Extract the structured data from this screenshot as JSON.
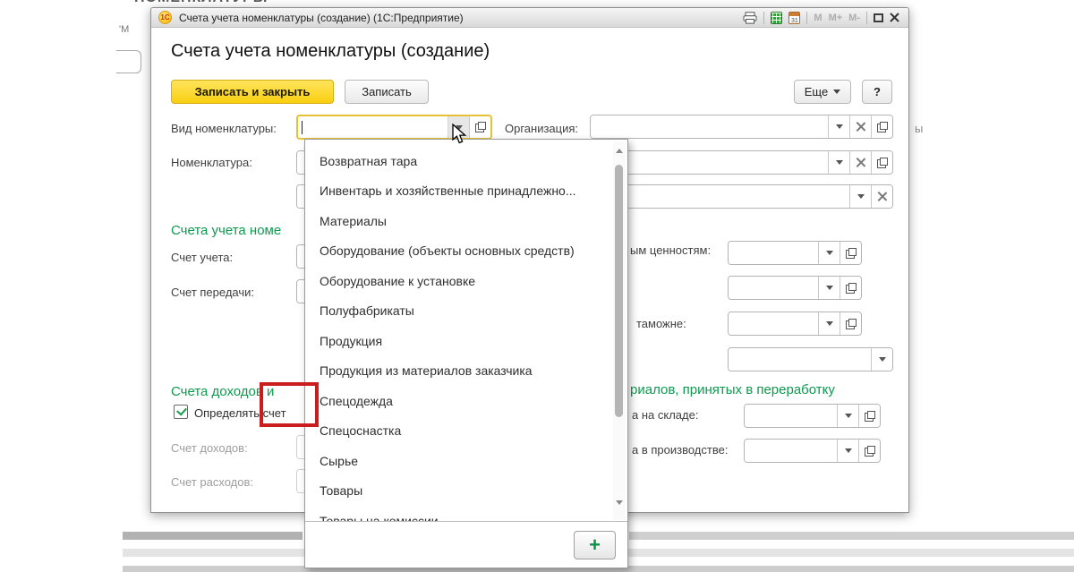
{
  "backdrop": {
    "top_fragment": "НОМЕНКЛАТУРЫ",
    "left_fragment": "'М",
    "right_fragment": "ы"
  },
  "titlebar": {
    "logo_text": "1С",
    "title": "Счета учета номенклатуры (создание)  (1С:Предприятие)",
    "calendar_day": "31",
    "memory_buttons": [
      "M",
      "M+",
      "M-"
    ]
  },
  "header": {
    "title": "Счета учета номенклатуры (создание)",
    "save_and_close": "Записать и закрыть",
    "save": "Записать",
    "more": "Еще",
    "help": "?"
  },
  "form": {
    "nomenclature_kind_label": "Вид номенклатуры:",
    "organization_label": "Организация:",
    "nomenclature_label": "Номенклатура:",
    "accounts_section_title_fragment": "Счета учета номе",
    "account_label": "Счет учета:",
    "transfer_account_label": "Счет передачи:",
    "income_section_title_fragment": "Счета доходов и",
    "checkbox_label_fragment": "Определять счет",
    "income_account_label": "Счет доходов:",
    "expense_account_label": "Счет расходов:",
    "right_valuables_label_fragment": "ым ценностям:",
    "right_customs_label_fragment": "таможне:",
    "right_section_title_fragment": "риалов, принятых в переработку",
    "right_warehouse_label_fragment": "а на складе:",
    "right_production_label_fragment": "а в производстве:"
  },
  "dropdown": {
    "items": [
      "Возвратная тара",
      "Инвентарь и хозяйственные принадлежно...",
      "Материалы",
      "Оборудование (объекты основных средств)",
      "Оборудование к установке",
      "Полуфабрикаты",
      "Продукция",
      "Продукция из материалов заказчика",
      "Спецодежда",
      "Спецоснастка",
      "Сырье",
      "Товары",
      "Товары на комиссии"
    ],
    "add_button": "+"
  },
  "colors": {
    "accent_yellow": "#f9cf11",
    "section_green": "#0c9a4e",
    "annotation_red": "#cb1d1d"
  }
}
